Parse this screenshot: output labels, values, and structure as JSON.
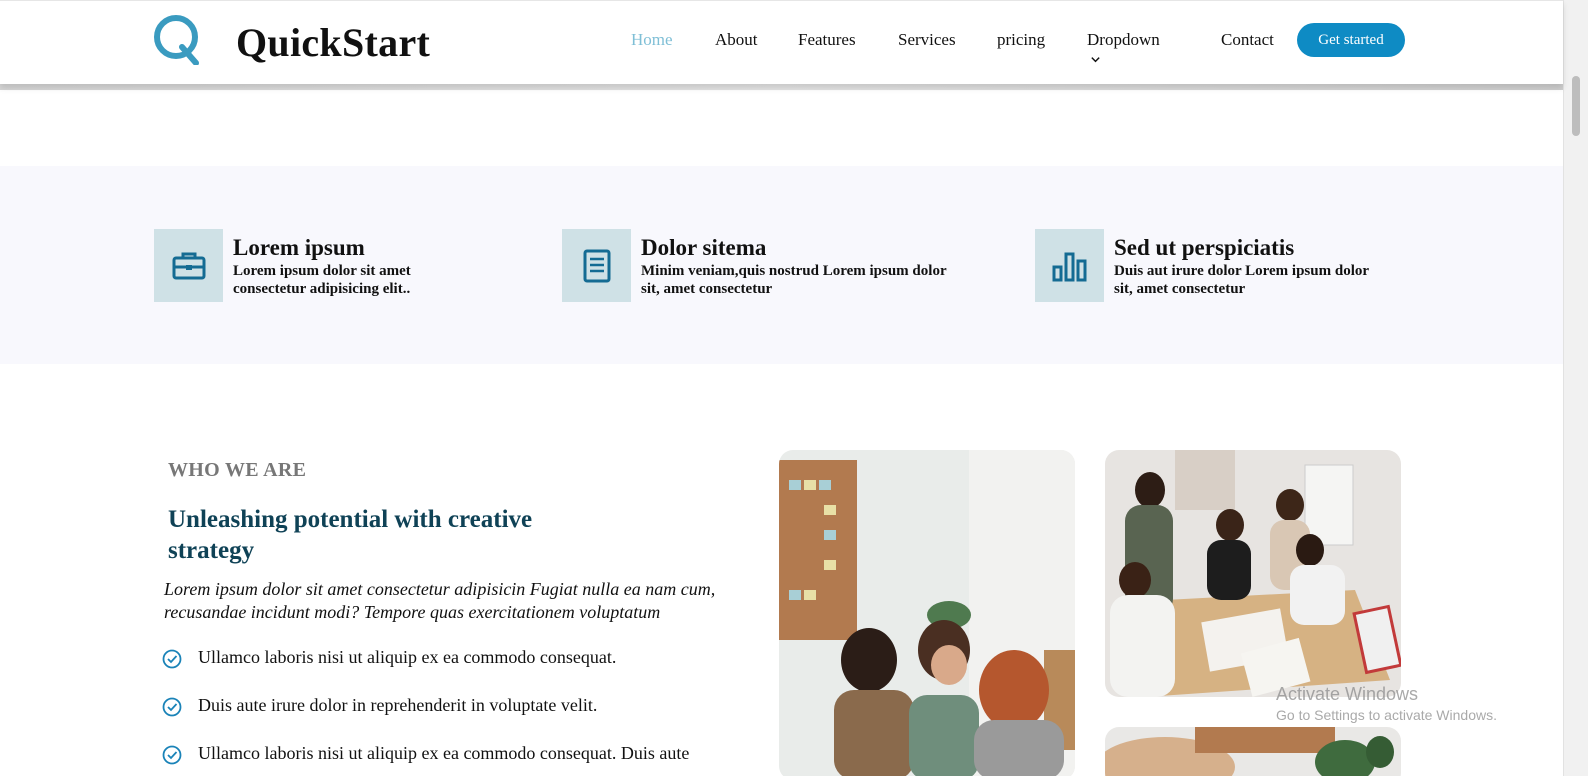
{
  "header": {
    "brand": "QuickStart",
    "nav": [
      {
        "label": "Home"
      },
      {
        "label": "About"
      },
      {
        "label": "Features"
      },
      {
        "label": "Services"
      },
      {
        "label": "pricing"
      },
      {
        "label": "Dropdown"
      },
      {
        "label": "Contact"
      }
    ],
    "cta_label": "Get started"
  },
  "features": [
    {
      "icon": "briefcase-icon",
      "title": "Lorem ipsum",
      "desc_1": "Lorem ipsum dolor sit amet",
      "desc_2": "consectetur adipisicing elit.."
    },
    {
      "icon": "document-icon",
      "title": "Dolor sitema",
      "desc_1": "Minim veniam,quis nostrud Lorem ipsum dolor",
      "desc_2": "sit, amet consectetur"
    },
    {
      "icon": "bar-chart-icon",
      "title": "Sed ut perspiciatis",
      "desc_1": "Duis aut irure dolor Lorem ipsum dolor",
      "desc_2": "sit, amet consectetur"
    }
  ],
  "about": {
    "eyebrow": "WHO WE ARE",
    "title_1": "Unleashing potential with creative",
    "title_2": "strategy",
    "lead_1": "Lorem ipsum dolor sit amet consectetur adipisicin Fugiat nulla ea nam cum,",
    "lead_2": "recusandae incidunt modi? Tempore quas exercitationem voluptatum",
    "checks": [
      "Ullamco laboris nisi ut aliquip ex ea commodo consequat.",
      "Duis aute irure dolor in reprehenderit in voluptate velit.",
      "Ullamco laboris nisi ut aliquip ex ea commodo consequat. Duis aute"
    ]
  },
  "watermark": {
    "line_1": "Activate Windows",
    "line_2": "Go to Settings to activate Windows."
  },
  "colors": {
    "accent": "#0e8bc4",
    "nav_active": "#7fbfd6",
    "heading": "#0f4256",
    "icon_bg": "#cfe1e6",
    "icon": "#146b93",
    "band_bg": "#f8f8fd"
  }
}
